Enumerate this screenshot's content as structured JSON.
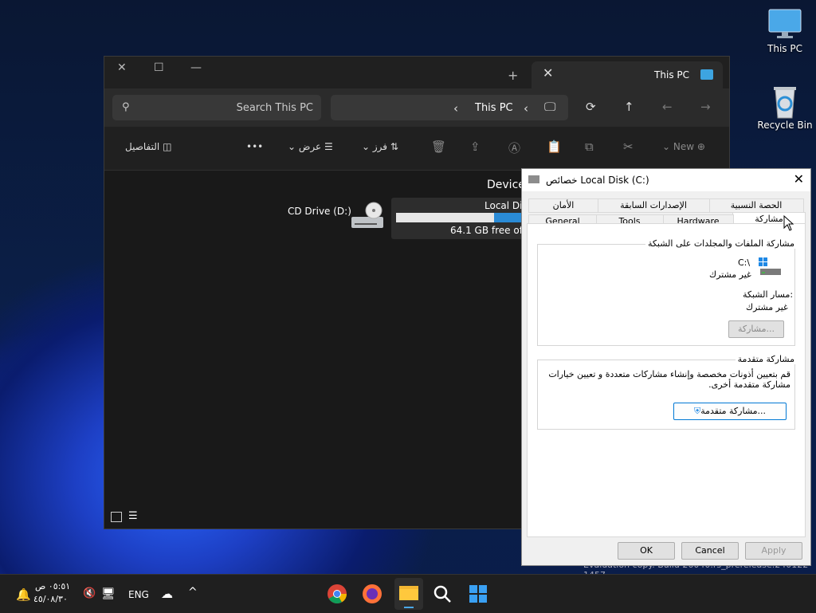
{
  "desktop": {
    "icons": [
      {
        "label": "This PC"
      },
      {
        "label": "Recycle Bin"
      }
    ],
    "watermark": "Evaluation copy. Build 26040.rs_prerelease.240122-1457"
  },
  "explorer": {
    "tab_title": "This PC",
    "search_placeholder": "Search This PC",
    "address": "This PC",
    "toolbar": {
      "new_label": "New",
      "sort_label": "فرز",
      "view_label": "عرض",
      "more_label": "•••",
      "details_label": "التفاصيل"
    },
    "section_header": "Devices",
    "drives": [
      {
        "name": "Local Disk (C:)",
        "free_text": "64.1 GB free of 99 GB",
        "used_fraction": 0.35
      },
      {
        "name": "CD Drive (D:)"
      }
    ]
  },
  "properties": {
    "title": "خصائص Local Disk (C:)",
    "tabs_row1": [
      "الحصة النسبية",
      "الإصدارات السابقة",
      "الأمان"
    ],
    "tabs_row2": [
      "مشاركة",
      "Hardware",
      "Tools",
      "General"
    ],
    "selected_tab": "مشاركة",
    "network_sharing": {
      "title": "مشاركة الملفات والمجلدات على الشبكة",
      "drive_path": "C:\\",
      "drive_status": "غير مشترك",
      "path_label": "مسار الشبكة:",
      "path_value": "غير مشترك",
      "share_button": "مشاركة..."
    },
    "advanced_sharing": {
      "title": "مشاركة متقدمة",
      "description": "قم بتعيين أذونات مخصصة وإنشاء مشاركات متعددة و تعيين خيارات مشاركة متقدمة أخرى.",
      "button": "مشاركة متقدمة..."
    },
    "buttons": {
      "ok": "OK",
      "cancel": "Cancel",
      "apply": "Apply"
    }
  },
  "taskbar": {
    "time": "٠٥:٥١ ص",
    "date": "٤٥/٠٨/٣٠",
    "language": "ENG"
  }
}
